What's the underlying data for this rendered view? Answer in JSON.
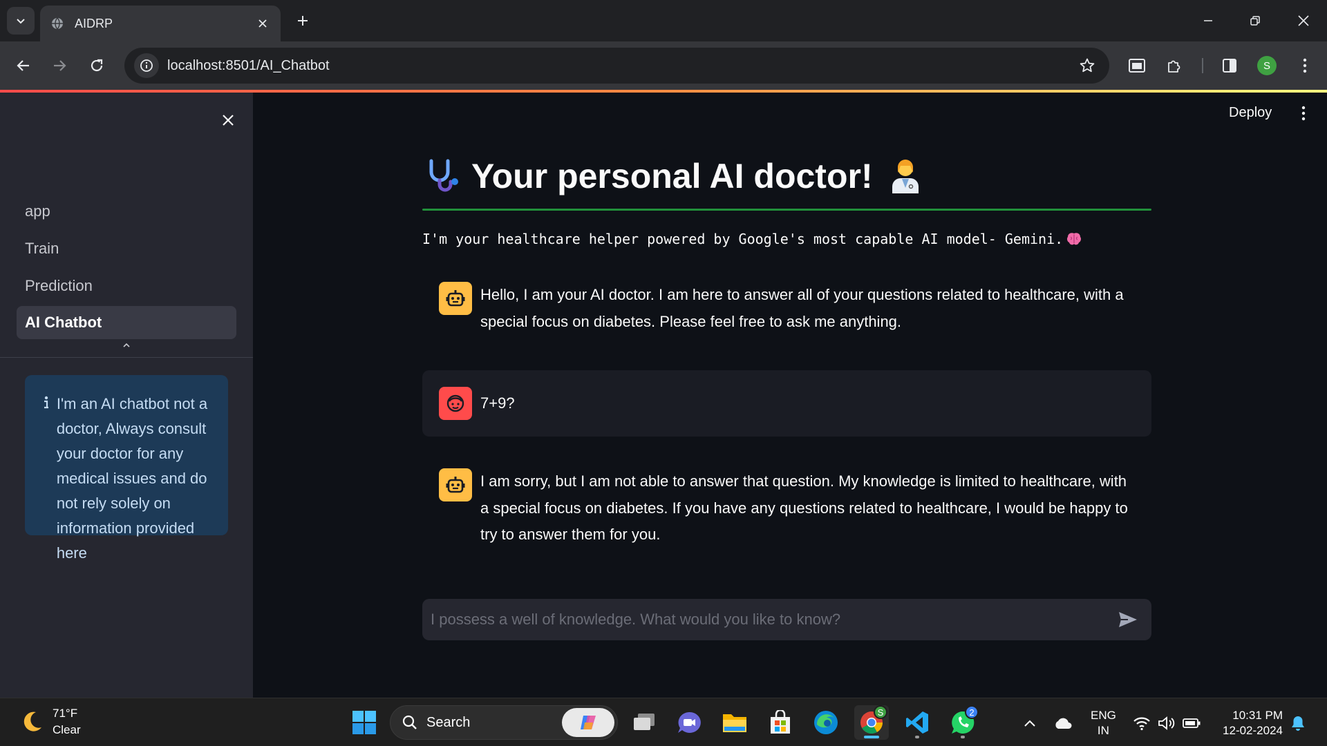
{
  "browser": {
    "tab_title": "AIDRP",
    "url": "localhost:8501/AI_Chatbot",
    "profile_initial": "S"
  },
  "app": {
    "deploy_label": "Deploy",
    "sidebar": {
      "items": [
        {
          "label": "app",
          "active": false
        },
        {
          "label": "Train",
          "active": false
        },
        {
          "label": "Prediction",
          "active": false
        },
        {
          "label": "AI Chatbot",
          "active": true
        }
      ],
      "info_text": "I'm an AI chatbot not a doctor, Always consult your doctor for any medical issues and do not rely solely on information provided here"
    },
    "title": "Your personal AI doctor!",
    "subtitle": "I'm your healthcare helper powered by Google's most capable AI model- Gemini.",
    "messages": [
      {
        "role": "assistant",
        "text": "Hello, I am your AI doctor. I am here to answer all of your questions related to healthcare, with a special focus on diabetes. Please feel free to ask me anything."
      },
      {
        "role": "user",
        "text": "7+9?"
      },
      {
        "role": "assistant",
        "text": "I am sorry, but I am not able to answer that question. My knowledge is limited to healthcare, with a special focus on diabetes. If you have any questions related to healthcare, I would be happy to try to answer them for you."
      }
    ],
    "chat_input_placeholder": "I possess a well of knowledge. What would you like to know?"
  },
  "taskbar": {
    "weather_temp": "71°F",
    "weather_desc": "Clear",
    "search_label": "Search",
    "whatsapp_badge": "2",
    "chrome_badge": "S",
    "lang_line1": "ENG",
    "lang_line2": "IN",
    "time": "10:31 PM",
    "date": "12-02-2024"
  },
  "colors": {
    "accent_red": "#ff4b4b",
    "bot_avatar": "#ffbd45",
    "title_divider": "#21903a",
    "info_bg": "#1d3a57"
  }
}
